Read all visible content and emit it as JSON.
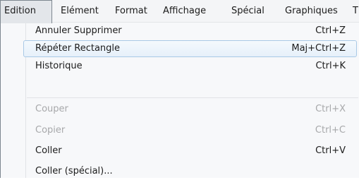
{
  "menubar": {
    "items": [
      {
        "label": "Edition",
        "active": true
      },
      {
        "label": "Elément"
      },
      {
        "label": "Format"
      },
      {
        "label": "Affichage"
      },
      {
        "label": "Spécial"
      },
      {
        "label": "Graphiques"
      },
      {
        "label": "T"
      }
    ]
  },
  "dropdown": {
    "items": [
      {
        "label": "Annuler Supprimer",
        "shortcut": "Ctrl+Z",
        "enabled": true
      },
      {
        "label": "Répéter Rectangle",
        "shortcut": "Maj+Ctrl+Z",
        "enabled": true,
        "highlighted": true
      },
      {
        "label": "Historique",
        "shortcut": "Ctrl+K",
        "enabled": true
      },
      {
        "label": "Couper",
        "shortcut": "Ctrl+X",
        "enabled": false
      },
      {
        "label": "Copier",
        "shortcut": "Ctrl+C",
        "enabled": false
      },
      {
        "label": "Coller",
        "shortcut": "Ctrl+V",
        "enabled": true
      },
      {
        "label": "Coller (spécial)...",
        "shortcut": "",
        "enabled": true
      }
    ]
  },
  "colors": {
    "highlight_border": "#a9c9e6",
    "disabled_text": "#a7a8aa",
    "menubar_bg": "#f4f5f7"
  }
}
